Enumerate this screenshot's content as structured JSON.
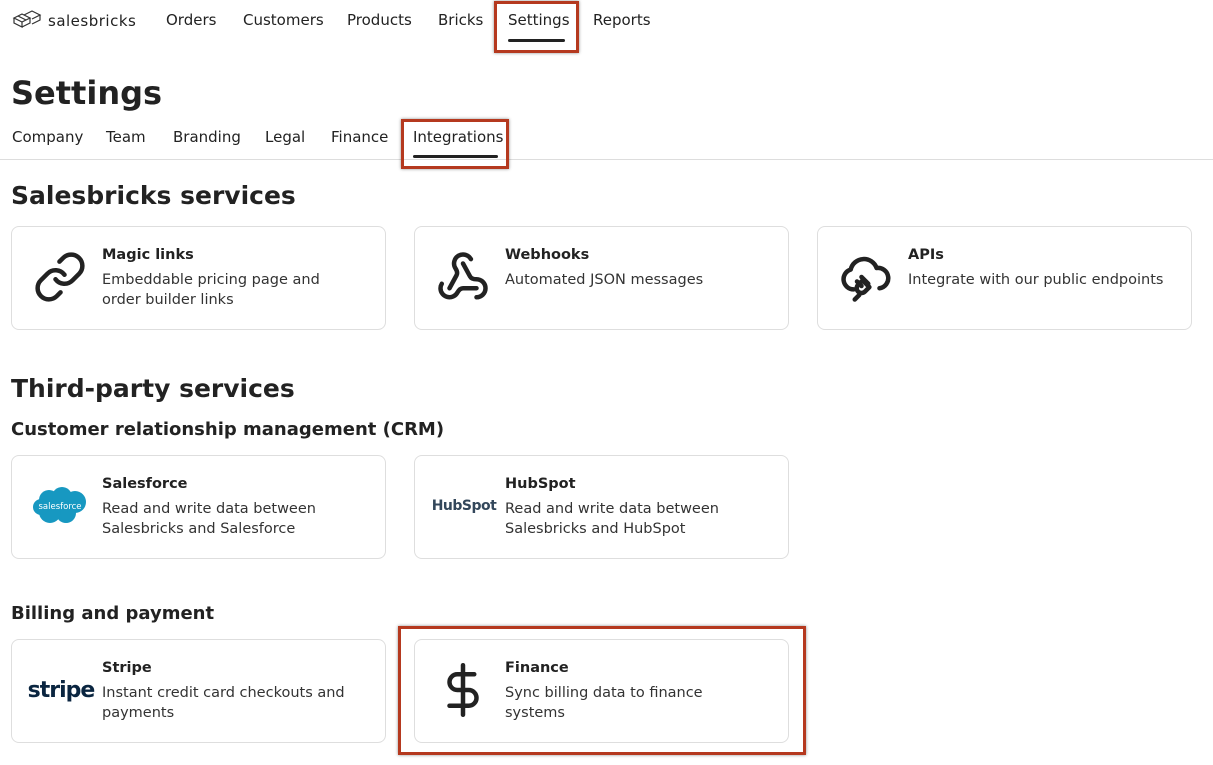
{
  "brand": {
    "name": "salesbricks"
  },
  "topnav": {
    "items": [
      "Orders",
      "Customers",
      "Products",
      "Bricks",
      "Settings",
      "Reports"
    ],
    "active": "Settings"
  },
  "page": {
    "title": "Settings"
  },
  "tabs": {
    "items": [
      "Company",
      "Team",
      "Branding",
      "Legal",
      "Finance",
      "Integrations"
    ],
    "active": "Integrations"
  },
  "sections": {
    "salesbricks": {
      "title": "Salesbricks services",
      "cards": [
        {
          "icon": "link-icon",
          "title": "Magic links",
          "description": "Embeddable pricing page and order builder links"
        },
        {
          "icon": "webhook-icon",
          "title": "Webhooks",
          "description": "Automated JSON messages"
        },
        {
          "icon": "cloud-plug-icon",
          "title": "APIs",
          "description": "Integrate with our public endpoints"
        }
      ]
    },
    "third_party": {
      "title": "Third-party services",
      "crm": {
        "title": "Customer relationship management (CRM)",
        "cards": [
          {
            "icon": "salesforce-logo",
            "logo_text": "salesforce",
            "title": "Salesforce",
            "description": "Read and write data between Salesbricks and Salesforce"
          },
          {
            "icon": "hubspot-logo",
            "logo_text": "HubSpot",
            "title": "HubSpot",
            "description": "Read and write data between Salesbricks and HubSpot"
          }
        ]
      },
      "billing": {
        "title": "Billing and payment",
        "cards": [
          {
            "icon": "stripe-logo",
            "logo_text": "stripe",
            "title": "Stripe",
            "description": "Instant credit card checkouts and payments"
          },
          {
            "icon": "dollar-icon",
            "title": "Finance",
            "description": "Sync billing data to finance systems"
          }
        ]
      }
    }
  },
  "colors": {
    "highlight": "#b5391f",
    "salesforce": "#1798c1",
    "stripe": "#0a2540",
    "text": "#222222"
  }
}
